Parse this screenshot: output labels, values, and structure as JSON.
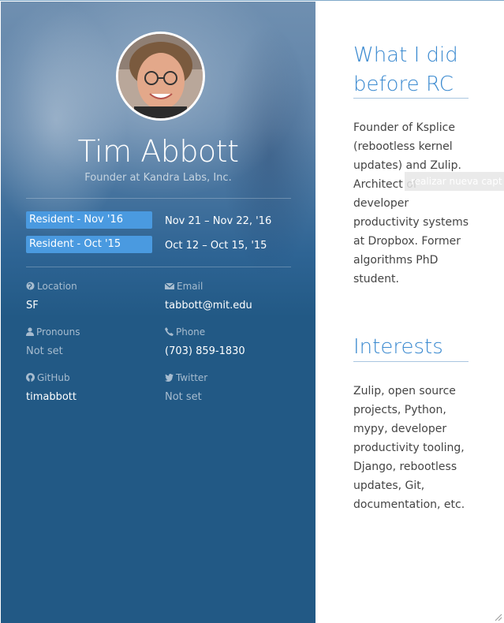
{
  "profile": {
    "name": "Tim Abbott",
    "title": "Founder at Kandra Labs, Inc."
  },
  "batches": [
    {
      "badge": "Resident - Nov '16",
      "dates": "Nov 21 – Nov 22, '16"
    },
    {
      "badge": "Resident - Oct '15",
      "dates": "Oct 12 – Oct 15, '15"
    }
  ],
  "details": {
    "location": {
      "label": "Location",
      "value": "SF"
    },
    "email": {
      "label": "Email",
      "value": "tabbott@mit.edu"
    },
    "pronouns": {
      "label": "Pronouns",
      "value": "Not set"
    },
    "phone": {
      "label": "Phone",
      "value": "(703) 859-1830"
    },
    "github": {
      "label": "GitHub",
      "value": "timabbott"
    },
    "twitter": {
      "label": "Twitter",
      "value": "Not set"
    }
  },
  "sections": {
    "before": {
      "heading_line1": "What I did",
      "heading_line2": "before RC",
      "text": "Founder of Ksplice (rebootless kernel updates) and Zulip. Architect of developer productivity systems at Dropbox. Former algorithms PhD student."
    },
    "interests": {
      "heading": "Interests",
      "text": "Zulip, open source projects, Python, mypy, developer productivity tooling, Django, rebootless updates, Git, documentation, etc."
    }
  },
  "tooltip": {
    "text": "realizar nueva capt"
  },
  "colors": {
    "panel": "#225985",
    "badge": "#4a9ae0",
    "accent": "#3b8ad0"
  }
}
